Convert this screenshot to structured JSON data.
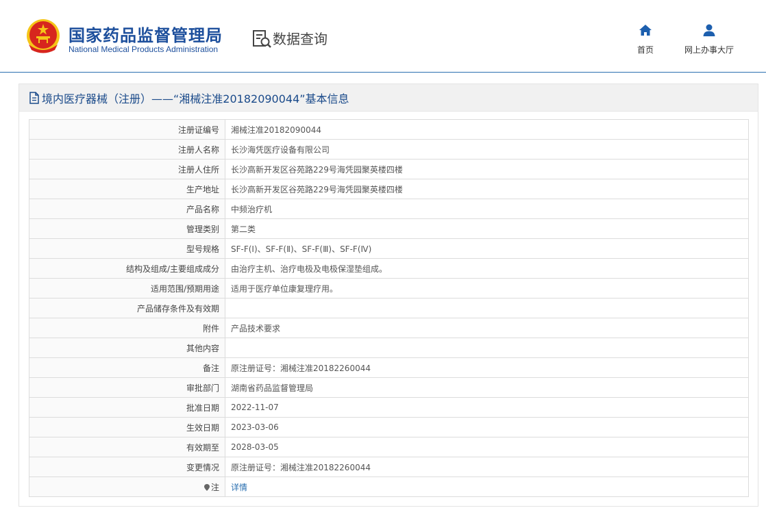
{
  "header": {
    "org_cn": "国家药品监督管理局",
    "org_en": "National Medical Products Administration",
    "query_title": "数据查询",
    "nav": [
      {
        "label": "首页",
        "icon": "home-icon"
      },
      {
        "label": "网上办事大厅",
        "icon": "user-icon"
      }
    ]
  },
  "panel": {
    "title": "境内医疗器械（注册）——“湘械注准20182090044”基本信息",
    "rows": [
      {
        "label": "注册证编号",
        "value": "湘械注准20182090044"
      },
      {
        "label": "注册人名称",
        "value": "长沙海凭医疗设备有限公司"
      },
      {
        "label": "注册人住所",
        "value": "长沙高新开发区谷苑路229号海凭园聚英楼四楼"
      },
      {
        "label": "生产地址",
        "value": "长沙高新开发区谷苑路229号海凭园聚英楼四楼"
      },
      {
        "label": "产品名称",
        "value": "中频治疗机"
      },
      {
        "label": "管理类别",
        "value": "第二类"
      },
      {
        "label": "型号规格",
        "value": "SF-F(Ⅰ)、SF-F(Ⅱ)、SF-F(Ⅲ)、SF-F(Ⅳ)"
      },
      {
        "label": "结构及组成/主要组成成分",
        "value": "由治疗主机、治疗电极及电极保湿垫组成。"
      },
      {
        "label": "适用范围/预期用途",
        "value": "适用于医疗单位康复理疗用。"
      },
      {
        "label": "产品储存条件及有效期",
        "value": ""
      },
      {
        "label": "附件",
        "value": "产品技术要求"
      },
      {
        "label": "其他内容",
        "value": ""
      },
      {
        "label": "备注",
        "value": "原注册证号：湘械注准20182260044"
      },
      {
        "label": "审批部门",
        "value": "湖南省药品监督管理局"
      },
      {
        "label": "批准日期",
        "value": "2022-11-07"
      },
      {
        "label": "生效日期",
        "value": "2023-03-06"
      },
      {
        "label": "有效期至",
        "value": "2028-03-05"
      },
      {
        "label": "变更情况",
        "value": "原注册证号：湘械注准20182260044"
      }
    ],
    "note_row": {
      "label": "注",
      "link": "详情"
    }
  },
  "colors": {
    "brand": "#1d4f9c",
    "link": "#2a6fb0",
    "emblem_red": "#d7261e",
    "emblem_gold": "#f5c518"
  }
}
